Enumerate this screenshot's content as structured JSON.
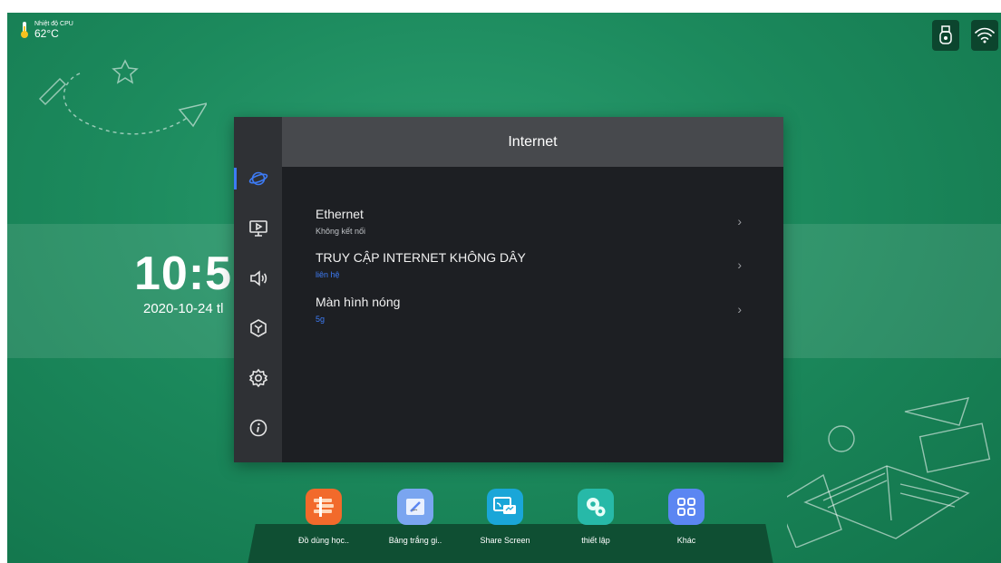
{
  "cpu": {
    "label": "Nhiệt độ CPU",
    "value": "62°C"
  },
  "clock": {
    "time": "10:5",
    "date": "2020-10-24 tl"
  },
  "dialog": {
    "title": "Internet",
    "sidebar": [
      {
        "icon": "globe-icon",
        "active": true
      },
      {
        "icon": "display-icon",
        "active": false
      },
      {
        "icon": "speaker-icon",
        "active": false
      },
      {
        "icon": "cube-icon",
        "active": false
      },
      {
        "icon": "gear-icon",
        "active": false
      },
      {
        "icon": "info-icon",
        "active": false
      }
    ],
    "items": [
      {
        "title": "Ethernet",
        "subtitle": "Không kết nối",
        "subtitle_color": "#bfc2c6"
      },
      {
        "title": "TRUY CẬP INTERNET KHÔNG DÂY",
        "subtitle": "liên hệ",
        "subtitle_color": "#3d7bf5"
      },
      {
        "title": "Màn hình nóng",
        "subtitle": "5g",
        "subtitle_color": "#3d7bf5"
      }
    ]
  },
  "dock": {
    "apps": [
      {
        "label": "Đồ dùng học..",
        "icon": "books-icon",
        "color": "#f26a2b"
      },
      {
        "label": "Bảng trắng gi..",
        "icon": "whiteboard-icon",
        "color": "#7aa5f0"
      },
      {
        "label": "Share Screen",
        "icon": "share-screen-icon",
        "color": "#1aa6d8"
      },
      {
        "label": "thiết lập",
        "icon": "settings-app-icon",
        "color": "#27b9a8"
      },
      {
        "label": "Khác",
        "icon": "grid-apps-icon",
        "color": "#5b86f2"
      }
    ]
  },
  "colors": {
    "accent": "#3d7bf5",
    "panel": "#1d1f23",
    "header": "#47494d"
  }
}
